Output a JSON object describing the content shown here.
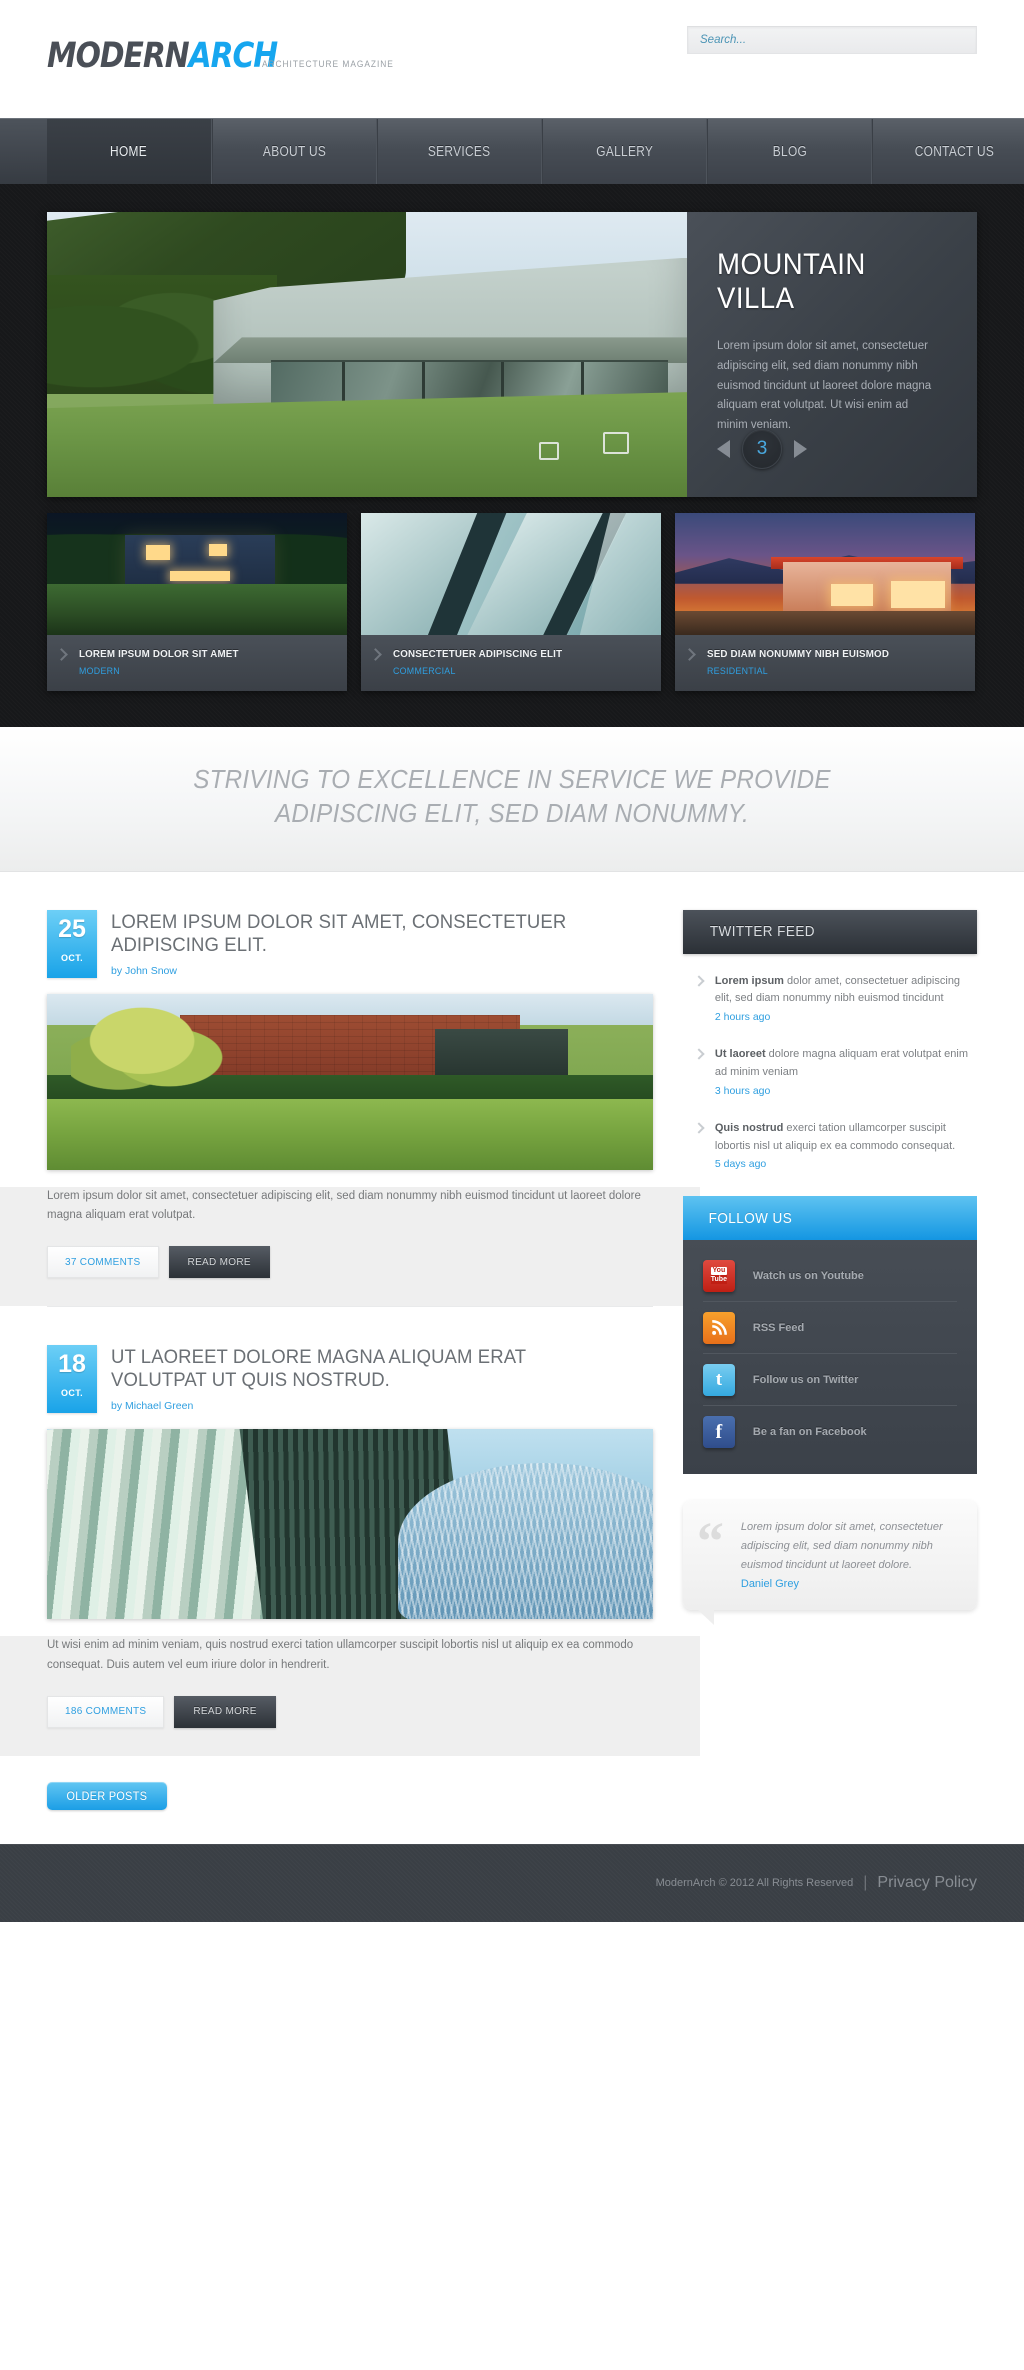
{
  "header": {
    "logo_modern": "MODERN",
    "logo_arch": "ARCH",
    "logo_sub": "ARCHITECTURE MAGAZINE",
    "search_placeholder": "Search...",
    "search_value": ""
  },
  "nav": {
    "items": [
      {
        "label": "HOME",
        "active": true
      },
      {
        "label": "ABOUT US",
        "active": false
      },
      {
        "label": "SERVICES",
        "active": false
      },
      {
        "label": "GALLERY",
        "active": false
      },
      {
        "label": "BLOG",
        "active": false
      },
      {
        "label": "CONTACT US",
        "active": false
      }
    ]
  },
  "slider": {
    "title_line1": "MOUNTAIN",
    "title_line2": "VILLA",
    "text": "Lorem ipsum dolor sit amet, consectetuer adipiscing elit, sed diam nonummy nibh euismod tincidunt ut laoreet dolore magna aliquam erat volutpat. Ut wisi enim ad minim veniam.",
    "slide_number": "3",
    "prev_label": "Previous slide",
    "next_label": "Next slide"
  },
  "thumbs": [
    {
      "title": "LOREM IPSUM DOLOR SIT AMET",
      "category": "MODERN"
    },
    {
      "title": "CONSECTETUER ADIPISCING ELIT",
      "category": "COMMERCIAL"
    },
    {
      "title": "SED DIAM NONUMMY NIBH EUISMOD",
      "category": "RESIDENTIAL"
    }
  ],
  "tagline": {
    "line1": "STRIVING TO EXCELLENCE IN SERVICE WE PROVIDE",
    "line2": "ADIPISCING ELIT, SED DIAM NONUMMY."
  },
  "posts": [
    {
      "day": "25",
      "month": "OCT.",
      "title": "LOREM IPSUM DOLOR SIT AMET, CONSECTETUER ADIPISCING ELIT.",
      "author": "by John Snow",
      "excerpt": "Lorem ipsum dolor sit amet, consectetuer adipiscing elit, sed diam nonummy nibh euismod tincidunt ut laoreet dolore magna aliquam erat volutpat.",
      "comments_label": "37 COMMENTS",
      "readmore_label": "READ MORE"
    },
    {
      "day": "18",
      "month": "OCT.",
      "title": "UT LAOREET DOLORE MAGNA ALIQUAM ERAT VOLUTPAT UT QUIS NOSTRUD.",
      "author": "by Michael Green",
      "excerpt": "Ut wisi enim ad minim veniam, quis nostrud exerci tation ullamcorper suscipit lobortis nisl ut aliquip ex ea commodo consequat. Duis autem vel eum iriure dolor in hendrerit.",
      "comments_label": "186 COMMENTS",
      "readmore_label": "READ MORE"
    }
  ],
  "older_posts_label": "OLDER POSTS",
  "twitter": {
    "title": "TWITTER FEED",
    "items": [
      {
        "lead": "Lorem ipsum",
        "text": " dolor amet, consectetuer adipiscing elit, sed diam nonummy nibh euismod tincidunt",
        "time": "2 hours ago"
      },
      {
        "lead": "Ut laoreet",
        "text": " dolore magna aliquam erat volutpat enim ad minim veniam",
        "time": "3 hours ago"
      },
      {
        "lead": "Quis nostrud",
        "text": " exerci tation ullamcorper suscipit lobortis nisl ut aliquip ex ea commodo consequat.",
        "time": "5 days ago"
      }
    ]
  },
  "follow": {
    "title": "FOLLOW US",
    "items": [
      {
        "icon": "youtube-icon",
        "label": "Watch us on Youtube"
      },
      {
        "icon": "rss-icon",
        "label": "RSS Feed"
      },
      {
        "icon": "twitter-icon",
        "label": "Follow us on Twitter"
      },
      {
        "icon": "facebook-icon",
        "label": "Be a fan on Facebook"
      }
    ]
  },
  "testimonial": {
    "quote_mark": "“",
    "text": "Lorem ipsum dolor sit amet, consectetuer adipiscing elit, sed diam nonummy nibh euismod tincidunt ut laoreet dolore.",
    "author": "Daniel Grey"
  },
  "footer": {
    "copyright": "ModernArch © 2012 All Rights Reserved",
    "separator": "|",
    "privacy": "Privacy Policy"
  },
  "colors": {
    "accent_blue": "#2f9fe0",
    "logo_blue": "#16a6ef",
    "dark_nav": "#474d55",
    "youtube_red": "#c01f14",
    "rss_orange": "#e8701a",
    "facebook_blue": "#2f4d8c"
  }
}
